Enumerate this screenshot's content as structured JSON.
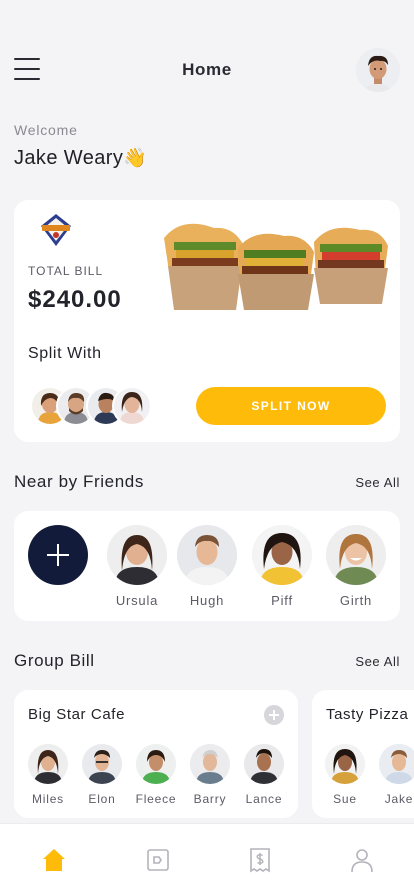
{
  "header": {
    "title": "Home",
    "menu_icon": "hamburger-menu-icon",
    "avatar_icon": "user-avatar"
  },
  "welcome": {
    "greeting": "Welcome",
    "name": "Jake Weary",
    "emoji": "👋"
  },
  "bill": {
    "logo_icon": "dinner-badge-logo",
    "total_label": "TOTAL BILL",
    "total_amount": "$240.00",
    "image": "burgers-in-paper-bags",
    "split_with_label": "Split With",
    "split_button": "SPLIT NOW"
  },
  "friends": {
    "title": "Near by Friends",
    "see_all": "See All",
    "add_icon": "plus-icon",
    "items": [
      {
        "name": "Ursula"
      },
      {
        "name": "Hugh"
      },
      {
        "name": "Piff"
      },
      {
        "name": "Girth"
      }
    ]
  },
  "groups": {
    "title": "Group Bill",
    "see_all": "See All",
    "cards": [
      {
        "name": "Big Star Cafe",
        "members": [
          "Miles",
          "Elon",
          "Fleece",
          "Barry",
          "Lance"
        ]
      },
      {
        "name": "Tasty Pizza",
        "members": [
          "Sue",
          "Jake"
        ]
      }
    ]
  },
  "tabbar": {
    "items": [
      {
        "icon": "home-icon",
        "active": true
      },
      {
        "icon": "tag-icon",
        "active": false
      },
      {
        "icon": "receipt-dollar-icon",
        "active": false
      },
      {
        "icon": "profile-icon",
        "active": false
      }
    ]
  },
  "colors": {
    "accent": "#ffbb0a",
    "navy": "#121c3a",
    "background": "#f4f4f6",
    "card": "#ffffff"
  }
}
